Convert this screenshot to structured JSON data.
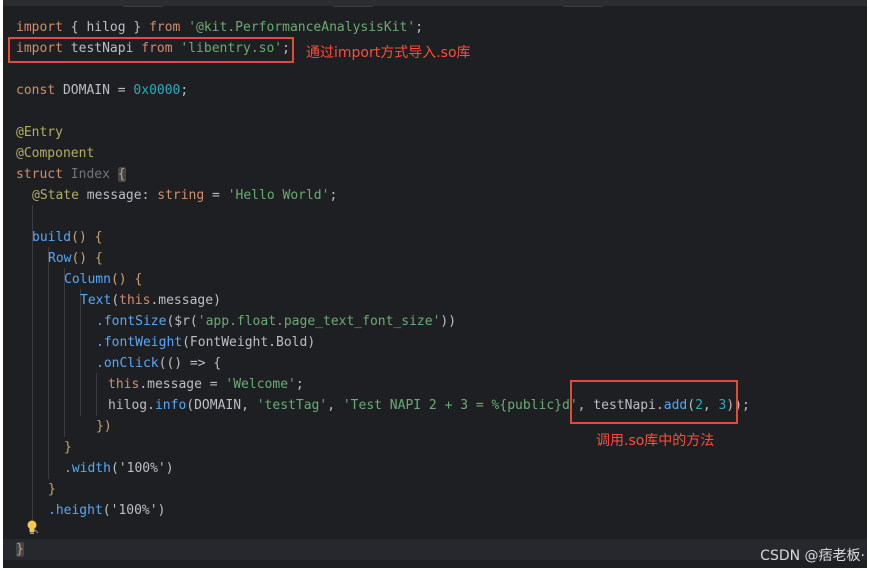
{
  "code": {
    "import_hilog_kw": "import",
    "import_hilog_braces": " { hilog } ",
    "import_hilog_from": "from",
    "import_hilog_src": "'@kit.PerformanceAnalysisKit'",
    "import_hilog_semi": ";",
    "import_napi_kw": "import",
    "import_napi_name": " testNapi ",
    "import_napi_from": "from",
    "import_napi_src": "'libentry.so'",
    "import_napi_semi": ";",
    "const_kw": "const",
    "const_name": " DOMAIN = ",
    "const_value": "0x0000",
    "const_semi": ";",
    "decorator_entry": "@Entry",
    "decorator_component": "@Component",
    "struct_kw": "struct",
    "struct_name": "Index",
    "open_brace": "{",
    "state_decorator": "@State",
    "state_decl": " message: ",
    "state_type": "string",
    "state_eq": " = ",
    "state_value": "'Hello World'",
    "state_semi": ";",
    "build_fn": "build",
    "build_rest": "() {",
    "row_fn": "Row",
    "row_rest": "() {",
    "column_fn": "Column",
    "column_rest": "() {",
    "text_fn": "Text",
    "text_open": "(",
    "this_kw": "this",
    "text_arg": ".message)",
    "fontsize_method": ".fontSize",
    "fontsize_arg": "($r(",
    "fontsize_res": "'app.float.page_text_font_size'",
    "fontsize_close": "))",
    "fontweight_method": ".fontWeight",
    "fontweight_arg": "(FontWeight.Bold)",
    "onclick_method": ".onClick",
    "onclick_arg": "(() => {",
    "assign_this": "this",
    "assign_rest": ".message = ",
    "assign_value": "'Welcome'",
    "assign_semi": ";",
    "hilog_obj": "hilog.",
    "hilog_method": "info",
    "hilog_args1": "(DOMAIN, ",
    "hilog_tag": "'testTag'",
    "hilog_comma": ", ",
    "hilog_fmt": "'Test NAPI 2 + 3 = %{public}d'",
    "hilog_args2": ", testNapi.",
    "add_method": "add",
    "add_args_open": "(",
    "add_arg1": "2",
    "add_comma": ", ",
    "add_arg2": "3",
    "add_close": "));",
    "onclick_close": "})",
    "column_close": "}",
    "width_method": ".width",
    "width_arg": "('100%')",
    "row_close": "}",
    "height_method": ".height",
    "height_arg": "('100%')",
    "final_close": "}"
  },
  "annotations": {
    "import_note": "通过import方式导入.so库",
    "call_note": "调用.so库中的方法"
  },
  "watermark": "CSDN @痞老板·"
}
